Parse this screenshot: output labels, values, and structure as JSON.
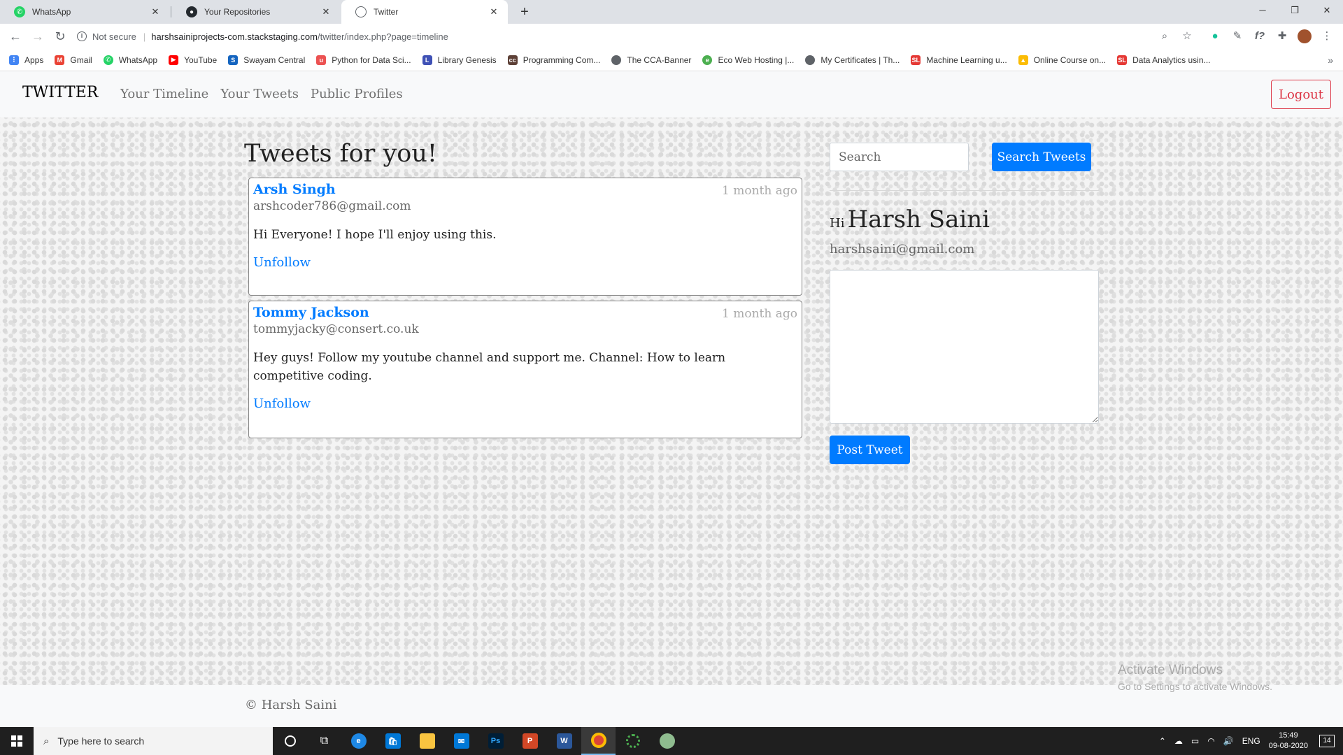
{
  "browser": {
    "tabs": [
      {
        "title": "WhatsApp",
        "icon": "whatsapp-icon",
        "color": "#25d366"
      },
      {
        "title": "Your Repositories",
        "icon": "github-icon",
        "color": "#24292e"
      },
      {
        "title": "Twitter",
        "icon": "globe-icon",
        "color": "#5f6368"
      }
    ],
    "url_notsecure": "Not secure",
    "url_host": "harshsainiprojects-com.stackstaging.com",
    "url_path": "/twitter/index.php?page=timeline",
    "bookmarks": [
      {
        "label": "Apps",
        "icon": "apps-grid-icon",
        "color": "#4285f4"
      },
      {
        "label": "Gmail",
        "icon": "gmail-icon",
        "color": "#ea4335"
      },
      {
        "label": "WhatsApp",
        "icon": "whatsapp-icon",
        "color": "#25d366"
      },
      {
        "label": "YouTube",
        "icon": "youtube-icon",
        "color": "#ff0000"
      },
      {
        "label": "Swayam Central",
        "icon": "swayam-icon",
        "color": "#1565c0"
      },
      {
        "label": "Python for Data Sci...",
        "icon": "udemy-icon",
        "color": "#ec5252"
      },
      {
        "label": "Library Genesis",
        "icon": "libgen-icon",
        "color": "#3f51b5"
      },
      {
        "label": "Programming Com...",
        "icon": "cc-icon",
        "color": "#5d4037"
      },
      {
        "label": "The CCA-Banner",
        "icon": "globe-icon",
        "color": "#5f6368"
      },
      {
        "label": "Eco Web Hosting |...",
        "icon": "eco-icon",
        "color": "#4caf50"
      },
      {
        "label": "My Certificates | Th...",
        "icon": "globe-icon",
        "color": "#5f6368"
      },
      {
        "label": "Machine Learning u...",
        "icon": "sl-icon",
        "color": "#e53935"
      },
      {
        "label": "Online Course on...",
        "icon": "drive-icon",
        "color": "#fbbc04"
      },
      {
        "label": "Data Analytics usin...",
        "icon": "sl-icon",
        "color": "#e53935"
      }
    ]
  },
  "nav": {
    "brand": "TWITTER",
    "links": [
      "Your Timeline",
      "Your Tweets",
      "Public Profiles"
    ],
    "logout": "Logout"
  },
  "main": {
    "heading": "Tweets for you!",
    "tweets": [
      {
        "name": "Arsh Singh",
        "time": "1 month ago",
        "email": "arshcoder786@gmail.com",
        "body": "Hi Everyone! I hope I'll enjoy using this.",
        "action": "Unfollow"
      },
      {
        "name": "Tommy Jackson",
        "time": "1 month ago",
        "email": "tommyjacky@consert.co.uk",
        "body": "Hey guys! Follow my youtube channel and support me. Channel: How to learn competitive coding.",
        "action": "Unfollow"
      }
    ]
  },
  "sidebar": {
    "search_placeholder": "Search",
    "search_button": "Search Tweets",
    "hi": "Hi",
    "user_name": "Harsh Saini",
    "user_email": "harshsaini@gmail.com",
    "post_button": "Post Tweet"
  },
  "footer": {
    "copyright": "© Harsh Saini"
  },
  "watermark": {
    "line1": "Activate Windows",
    "line2": "Go to Settings to activate Windows."
  },
  "taskbar": {
    "search_placeholder": "Type here to search",
    "lang": "ENG",
    "time": "15:49",
    "date": "09-08-2020",
    "notifications": "14"
  },
  "colors": {
    "primary": "#007bff",
    "danger": "#dc3545"
  }
}
